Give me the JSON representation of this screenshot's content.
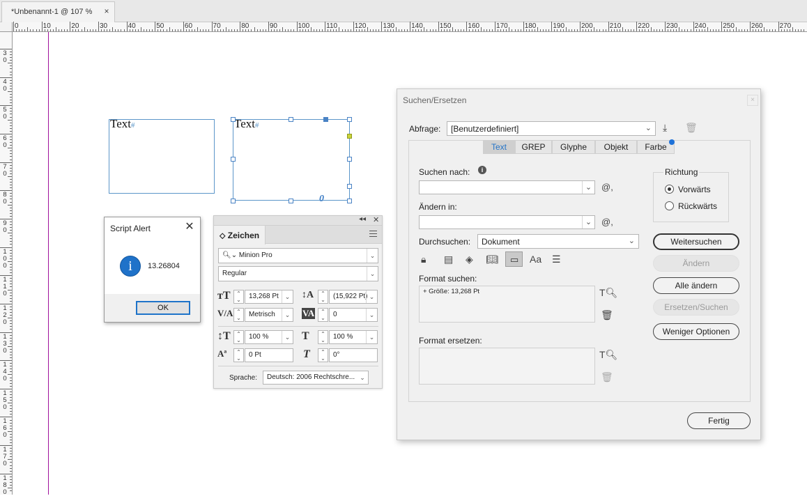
{
  "document": {
    "tab_title": "*Unbenannt-1 @ 107 %",
    "close_glyph": "×"
  },
  "rulers": {
    "horizontal_labels": [
      "0",
      "10",
      "20",
      "30",
      "40",
      "50",
      "60",
      "70",
      "80",
      "90",
      "100",
      "110",
      "120",
      "130",
      "140",
      "150",
      "160",
      "170",
      "180",
      "190",
      "200",
      "210",
      "220",
      "230",
      "240",
      "250",
      "260",
      "270"
    ],
    "vertical_labels": [
      "30",
      "40",
      "50",
      "60",
      "70",
      "80",
      "90",
      "100",
      "110",
      "120",
      "130",
      "140",
      "150",
      "160",
      "170",
      "180"
    ]
  },
  "canvas": {
    "frame1_text": "Text",
    "frame2_text": "Text",
    "hash_glyph": "#",
    "overset_glyph": "0"
  },
  "script_alert": {
    "title": "Script Alert",
    "message": "13.26804",
    "ok_label": "OK",
    "icon_glyph": "i"
  },
  "zeichen_panel": {
    "tab_label": "Zeichen",
    "font_family": "Minion Pro",
    "font_style": "Regular",
    "size": "13,268 Pt",
    "leading": "(15,922 Pt)",
    "kerning": "Metrisch",
    "tracking": "0",
    "vertical_scale": "100 %",
    "horizontal_scale": "100 %",
    "baseline_shift": "0 Pt",
    "skew": "0°",
    "language_label": "Sprache:",
    "language_value": "Deutsch: 2006 Rechtschre..."
  },
  "find_replace": {
    "title": "Suchen/Ersetzen",
    "query_label": "Abfrage:",
    "query_value": "[Benutzerdefiniert]",
    "tabs": [
      "Text",
      "GREP",
      "Glyphe",
      "Objekt",
      "Farbe"
    ],
    "active_tab": "Text",
    "find_label": "Suchen nach:",
    "find_value": "",
    "change_label": "Ändern in:",
    "change_value": "",
    "search_label": "Durchsuchen:",
    "search_value": "Dokument",
    "find_format_label": "Format suchen:",
    "find_format_value": "+ Größe: 13,268 Pt",
    "change_format_label": "Format ersetzen:",
    "direction_label": "Richtung",
    "direction_forward": "Vorwärts",
    "direction_backward": "Rückwärts",
    "direction_selected": "Vorwärts",
    "btn_find_next": "Weitersuchen",
    "btn_change": "Ändern",
    "btn_change_all": "Alle ändern",
    "btn_change_find": "Ersetzen/Suchen",
    "btn_fewer_options": "Weniger Optionen",
    "btn_done": "Fertig",
    "close_glyph": "×"
  },
  "colors": {
    "accent": "#1f72c9",
    "guide": "#a0129c",
    "frame": "#5b95c9",
    "tab_active_text": "#2574c7"
  }
}
